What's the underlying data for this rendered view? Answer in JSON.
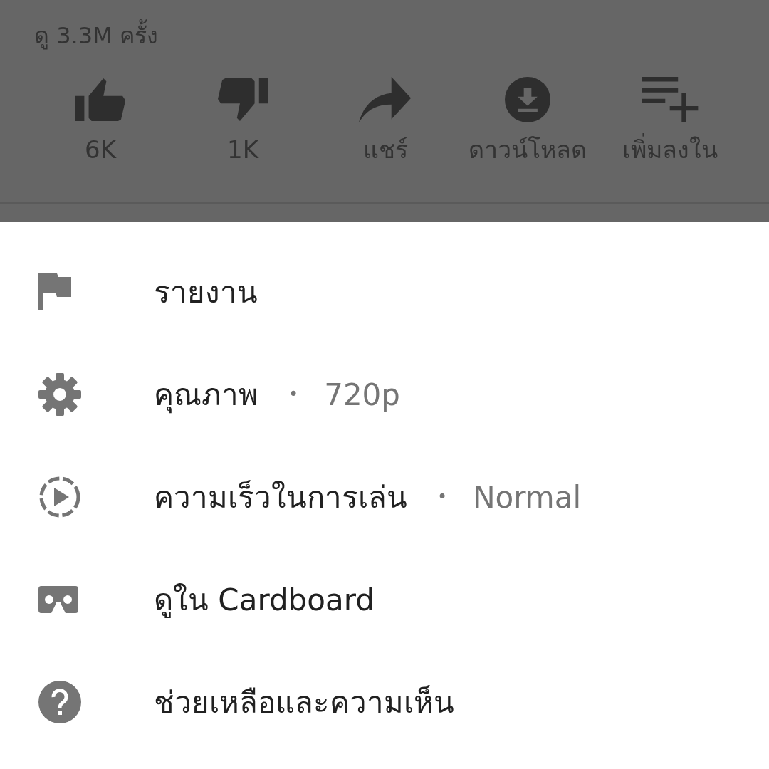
{
  "video": {
    "views": "ดู 3.3M ครั้ง",
    "actions": [
      {
        "label": "6K"
      },
      {
        "label": "1K"
      },
      {
        "label": "แชร์"
      },
      {
        "label": "ดาวน์โหลด"
      },
      {
        "label": "เพิ่มลงใน"
      }
    ]
  },
  "menu": {
    "items": [
      {
        "label": "รายงาน"
      },
      {
        "label": "คุณภาพ",
        "separator": "•",
        "value": "720p"
      },
      {
        "label": "ความเร็วในการเล่น",
        "separator": "•",
        "value": "Normal"
      },
      {
        "label": "ดูใน Cardboard"
      },
      {
        "label": "ช่วยเหลือและความเห็น"
      }
    ]
  }
}
